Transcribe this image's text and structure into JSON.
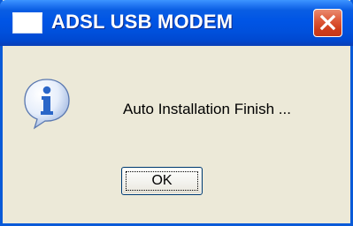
{
  "window": {
    "title": "ADSL USB MODEM",
    "title_icon": "window-app-icon",
    "close_icon": "close-icon"
  },
  "dialog": {
    "icon": "info-icon",
    "message": "Auto Installation Finish ...",
    "ok_label": "OK"
  },
  "colors": {
    "titlebar": "#0055e5",
    "frame": "#0a5ad8",
    "dialog_bg": "#ece9d8",
    "close_button": "#d9512f",
    "info_icon_blue": "#2a66c8"
  }
}
